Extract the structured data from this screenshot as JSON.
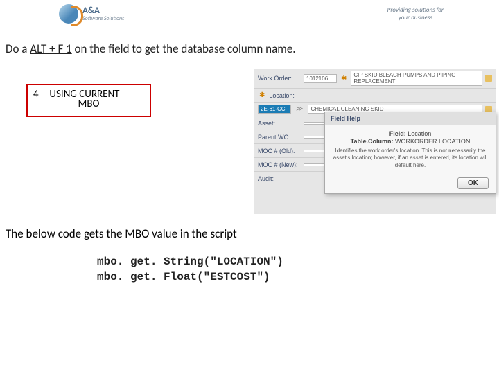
{
  "header": {
    "company_name": "A&A",
    "company_sub": "Software Solutions",
    "tagline_l1": "Providing solutions for",
    "tagline_l2": "your business"
  },
  "instruction": {
    "prefix": "Do a ",
    "shortcut": "ALT + F 1",
    "suffix": " on the field to get the database column name."
  },
  "mbo_box": {
    "num": "4",
    "line1": "USING CURRENT",
    "line2": "MBO"
  },
  "app": {
    "rows": {
      "wo_label": "Work Order:",
      "wo_value": "1012106",
      "wo_desc": "CIP SKID BLEACH PUMPS AND PIPING REPLACEMENT",
      "loc_label": "Location:",
      "loc_value": "2E-61-CC",
      "loc_desc": "CHEMICAL CLEANING SKID",
      "asset_label": "Asset:",
      "parent_label": "Parent WO:",
      "moc_old_label": "MOC # (Old):",
      "moc_new_label": "MOC # (New):",
      "audit_label": "Audit:"
    }
  },
  "help": {
    "title": "Field Help",
    "field_lbl": "Field:",
    "field_val": "Location",
    "col_lbl": "Table.Column:",
    "col_val": "WORKORDER.LOCATION",
    "desc": "Identifies the work order's location. This is not necessarily the asset's location; however, if an asset is entered, its location will default here.",
    "ok": "OK"
  },
  "below": "The below code gets the MBO value in the script",
  "code": {
    "l1": "mbo. get. String(\"LOCATION\")",
    "l2": "mbo. get. Float(\"ESTCOST\")"
  }
}
